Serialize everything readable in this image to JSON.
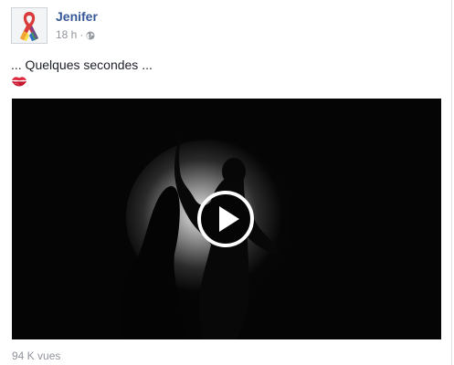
{
  "post": {
    "author": "Jenifer",
    "timestamp": "18 h",
    "separator": "·",
    "privacy_icon": "globe-icon",
    "text": "... Quelques secondes ...",
    "emoji": "kiss-mark-icon",
    "video": {
      "play_icon": "play-icon"
    },
    "views": "94 K vues"
  },
  "colors": {
    "author_link": "#365899",
    "meta_text": "#90949c",
    "body_text": "#1d2129",
    "video_bg": "#050505"
  }
}
